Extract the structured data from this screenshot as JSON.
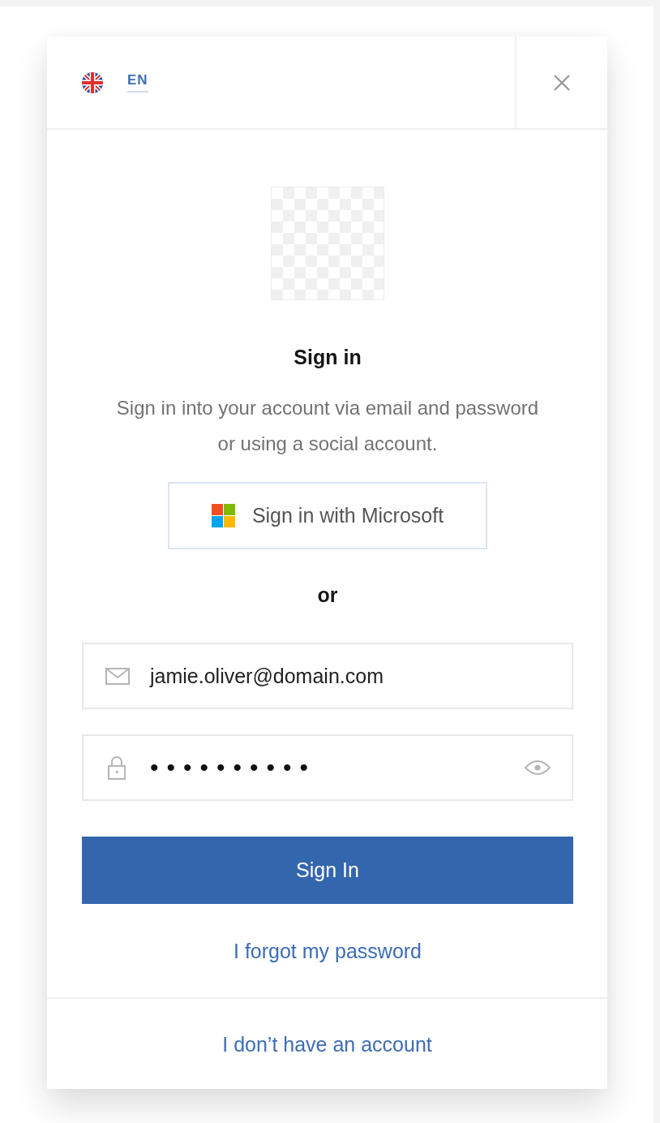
{
  "header": {
    "language_code": "EN"
  },
  "title": "Sign in",
  "description": "Sign in into your account via email and password or using a social account.",
  "social_button": {
    "label": "Sign in with Microsoft"
  },
  "separator": "or",
  "fields": [
    {
      "kind": "email",
      "value": "jamie.oliver@domain.com"
    },
    {
      "kind": "password",
      "value": "••••••••••"
    }
  ],
  "submit_button": "Sign In",
  "forgot_link": "I forgot my password",
  "footer": {
    "register_link": "I don’t have an account"
  }
}
